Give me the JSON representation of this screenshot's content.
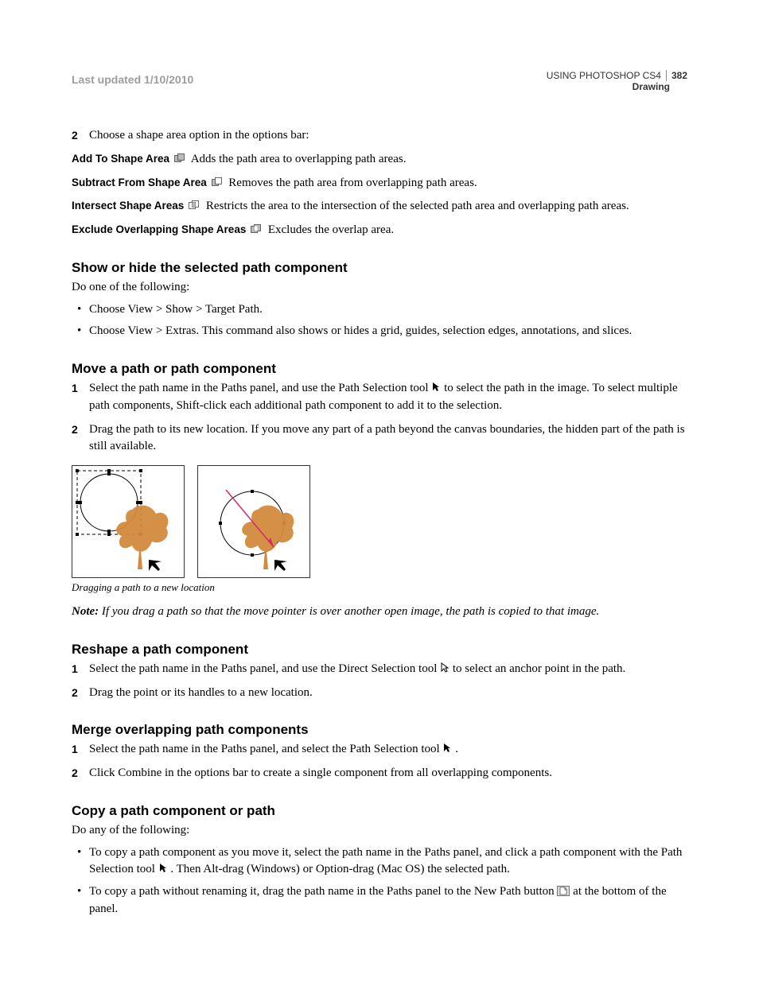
{
  "header": {
    "updated": "Last updated 1/10/2010",
    "product": "USING PHOTOSHOP CS4",
    "section": "Drawing",
    "page": "382"
  },
  "steps_top": {
    "num": "2",
    "text": "Choose a shape area option in the options bar:"
  },
  "shape_options": [
    {
      "label": "Add To Shape Area",
      "icon": "add-shape",
      "desc": "Adds the path area to overlapping path areas."
    },
    {
      "label": "Subtract From Shape Area",
      "icon": "subtract-shape",
      "desc": "Removes the path area from overlapping path areas."
    },
    {
      "label": "Intersect Shape Areas",
      "icon": "intersect-shape",
      "desc": "Restricts the area to the intersection of the selected path area and overlapping path areas."
    },
    {
      "label": "Exclude Overlapping Shape Areas",
      "icon": "exclude-shape",
      "desc": "Excludes the overlap area."
    }
  ],
  "sections": {
    "showhide": {
      "title": "Show or hide the selected path component",
      "lead": "Do one of the following:",
      "bullets": [
        "Choose View > Show > Target Path.",
        "Choose View > Extras. This command also shows or hides a grid, guides, selection edges, annotations, and slices."
      ]
    },
    "move": {
      "title": "Move a path or path component",
      "steps": [
        {
          "num": "1",
          "text_before": "Select the path name in the Paths panel, and use the Path Selection tool ",
          "text_after": " to select the path in the image. To select multiple path components, Shift-click each additional path component to add it to the selection."
        },
        {
          "num": "2",
          "text": "Drag the path to its new location. If you move any part of a path beyond the canvas boundaries, the hidden part of the path is still available."
        }
      ],
      "caption": "Dragging a path to a new location",
      "note_label": "Note:",
      "note_text": " If you drag a path so that the move pointer is over another open image, the path is copied to that image."
    },
    "reshape": {
      "title": "Reshape a path component",
      "steps": [
        {
          "num": "1",
          "text_before": "Select the path name in the Paths panel, and use the Direct Selection tool ",
          "text_after": " to select an anchor point in the path."
        },
        {
          "num": "2",
          "text": "Drag the point or its handles to a new location."
        }
      ]
    },
    "merge": {
      "title": "Merge overlapping path components",
      "steps": [
        {
          "num": "1",
          "text_before": "Select the path name in the Paths panel, and select the Path Selection tool ",
          "text_after": " ."
        },
        {
          "num": "2",
          "text": "Click Combine in the options bar to create a single component from all overlapping components."
        }
      ]
    },
    "copy": {
      "title": "Copy a path component or path",
      "lead": "Do any of the following:",
      "bullets": [
        {
          "before": "To copy a path component as you move it, select the path name in the Paths panel, and click a path component with the Path Selection tool ",
          "after": " . Then Alt-drag (Windows) or Option-drag (Mac OS) the selected path."
        },
        {
          "before": "To copy a path without renaming it, drag the path name in the Paths panel to the New Path button ",
          "after": " at the bottom of the panel."
        }
      ]
    }
  }
}
